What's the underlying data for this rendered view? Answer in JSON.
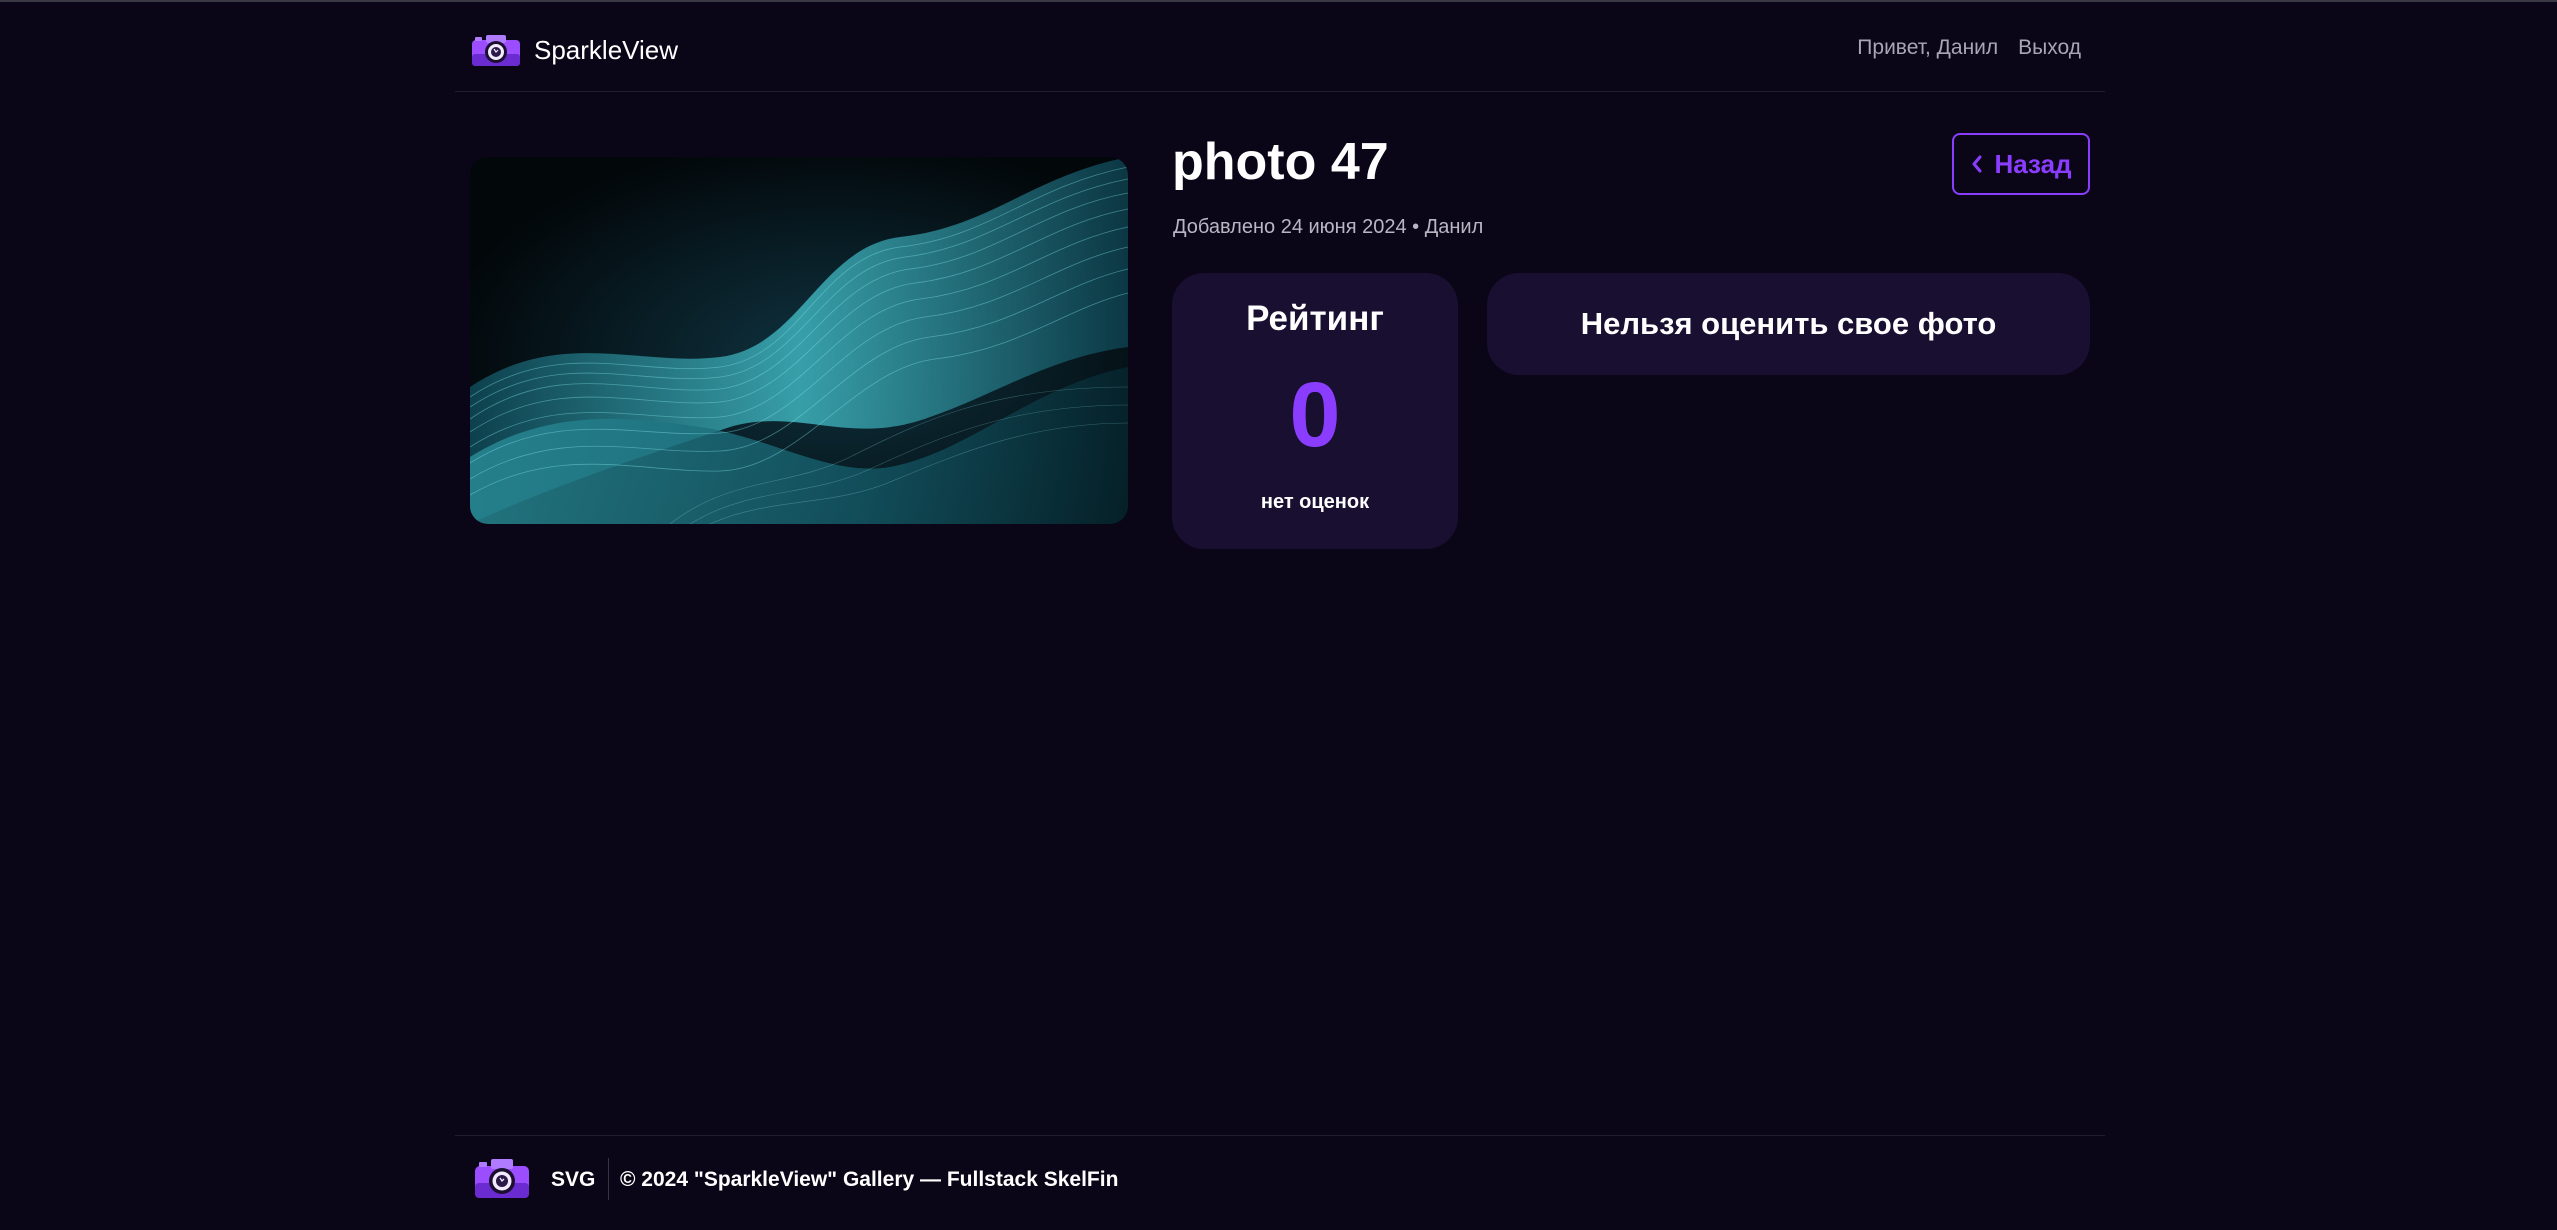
{
  "header": {
    "brand_name": "SparkleView",
    "logo_icon": "camera-icon",
    "nav": {
      "greeting": "Привет, Данил",
      "logout": "Выход"
    }
  },
  "photo": {
    "title": "photo 47",
    "meta": "Добавлено 24 июня 2024 • Данил",
    "image_icon": "abstract-teal-waves-image"
  },
  "actions": {
    "back_label": "Назад",
    "back_icon": "chevron-left-icon"
  },
  "rating": {
    "title": "Рейтинг",
    "value": "0",
    "subtitle": "нет оценок"
  },
  "rate_notice": "Нельзя оценить свое фото",
  "footer": {
    "logo_icon": "camera-icon",
    "svg_label": "SVG",
    "copyright": "© 2024 \"SparkleView\" Gallery — Fullstack SkelFin"
  },
  "colors": {
    "background": "#0a0617",
    "card": "#180f31",
    "accent": "#8b3dff",
    "muted_text": "#a9a6b4"
  }
}
